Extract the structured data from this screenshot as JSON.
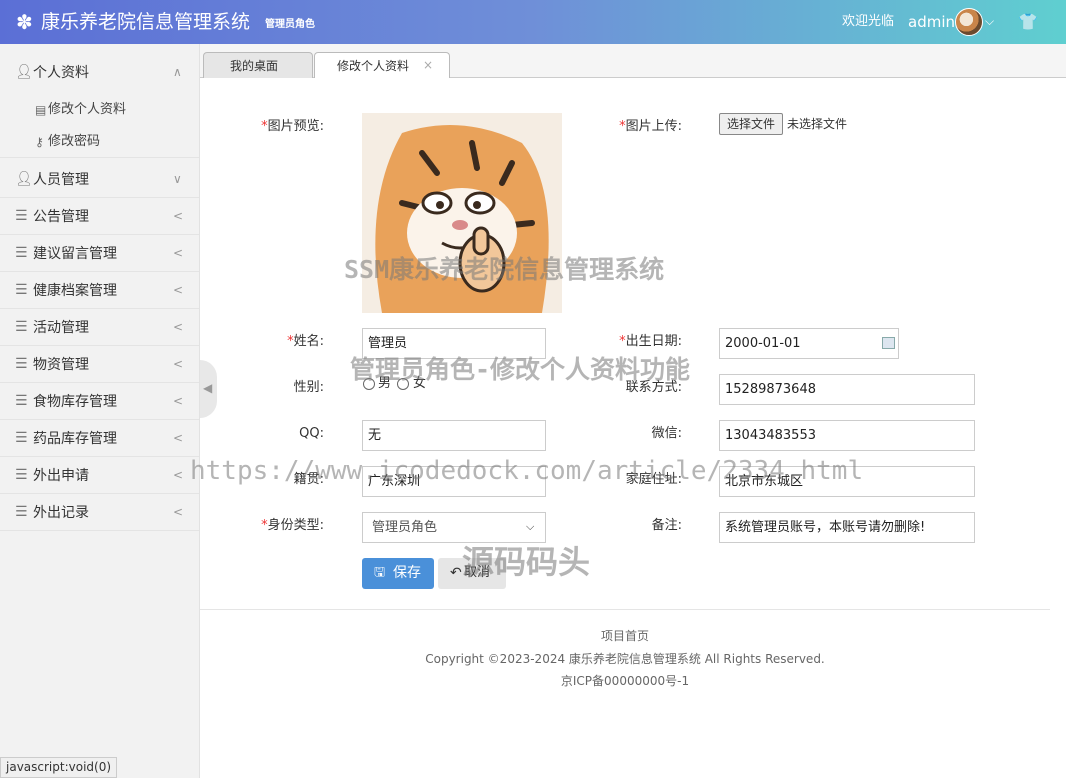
{
  "header": {
    "title": "康乐养老院信息管理系统",
    "role_tag": "管理员角色",
    "welcome": "欢迎光临",
    "username": "admin"
  },
  "tabs": [
    {
      "label": "我的桌面"
    },
    {
      "label": "修改个人资料",
      "close": "×"
    }
  ],
  "sidebar": {
    "items": [
      {
        "label": "个人资料",
        "icon": "user-icon",
        "arrow": "∧",
        "children": [
          {
            "label": "修改个人资料",
            "icon": "edit-icon"
          },
          {
            "label": "修改密码",
            "icon": "key-icon"
          }
        ]
      },
      {
        "label": "人员管理",
        "icon": "user-icon",
        "arrow": "∨"
      },
      {
        "label": "公告管理",
        "icon": "list-icon",
        "arrow": "<"
      },
      {
        "label": "建议留言管理",
        "icon": "list-icon",
        "arrow": "<"
      },
      {
        "label": "健康档案管理",
        "icon": "list-icon",
        "arrow": "<"
      },
      {
        "label": "活动管理",
        "icon": "list-icon",
        "arrow": "<"
      },
      {
        "label": "物资管理",
        "icon": "list-icon",
        "arrow": "<"
      },
      {
        "label": "食物库存管理",
        "icon": "list-icon",
        "arrow": "<"
      },
      {
        "label": "药品库存管理",
        "icon": "list-icon",
        "arrow": "<"
      },
      {
        "label": "外出申请",
        "icon": "list-icon",
        "arrow": "<"
      },
      {
        "label": "外出记录",
        "icon": "list-icon",
        "arrow": "<"
      }
    ]
  },
  "form": {
    "image_preview_label": "图片预览:",
    "image_upload_label": "图片上传:",
    "file_button": "选择文件",
    "file_status": "未选择文件",
    "name_label": "姓名:",
    "name_value": "管理员",
    "birth_label": "出生日期:",
    "birth_value": "2000-01-01",
    "gender_label": "性别:",
    "gender_male": "男",
    "gender_female": "女",
    "phone_label": "联系方式:",
    "phone_value": "15289873648",
    "qq_label": "QQ:",
    "qq_value": "无",
    "wechat_label": "微信:",
    "wechat_value": "13043483553",
    "native_label": "籍贯:",
    "native_value": "广东深圳",
    "address_label": "家庭住址:",
    "address_value": "北京市东城区",
    "identity_label": "身份类型:",
    "identity_value": "管理员角色",
    "remark_label": "备注:",
    "remark_value": "系统管理员账号，本账号请勿删除!",
    "save_button": "保存",
    "cancel_button": "取消"
  },
  "footer": {
    "home_link": "项目首页",
    "copyright": "Copyright ©2023-2024 康乐养老院信息管理系统 All Rights Reserved.",
    "icp": "京ICP备00000000号-1"
  },
  "watermarks": {
    "line1": "SSM康乐养老院信息管理系统",
    "line2": "管理员角色-修改个人资料功能",
    "url": "https://www.icodedock.com/article/2334.html",
    "brand": "源码码头"
  },
  "statusbar": "javascript:void(0)"
}
